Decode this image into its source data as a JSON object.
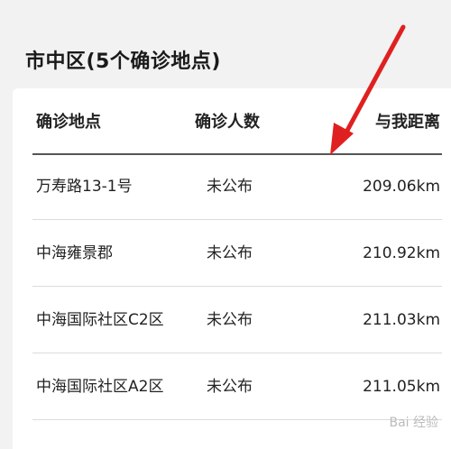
{
  "section_title": "市中区(5个确诊地点)",
  "table": {
    "headers": [
      "确诊地点",
      "确诊人数",
      "与我距离"
    ],
    "rows": [
      {
        "place": "万寿路13-1号",
        "count": "未公布",
        "distance": "209.06km"
      },
      {
        "place": "中海雍景郡",
        "count": "未公布",
        "distance": "210.92km"
      },
      {
        "place": "中海国际社区C2区",
        "count": "未公布",
        "distance": "211.03km"
      },
      {
        "place": "中海国际社区A2区",
        "count": "未公布",
        "distance": "211.05km"
      }
    ]
  },
  "annotation": {
    "type": "arrow",
    "color": "#e02020"
  },
  "watermark": "Bai 经验"
}
